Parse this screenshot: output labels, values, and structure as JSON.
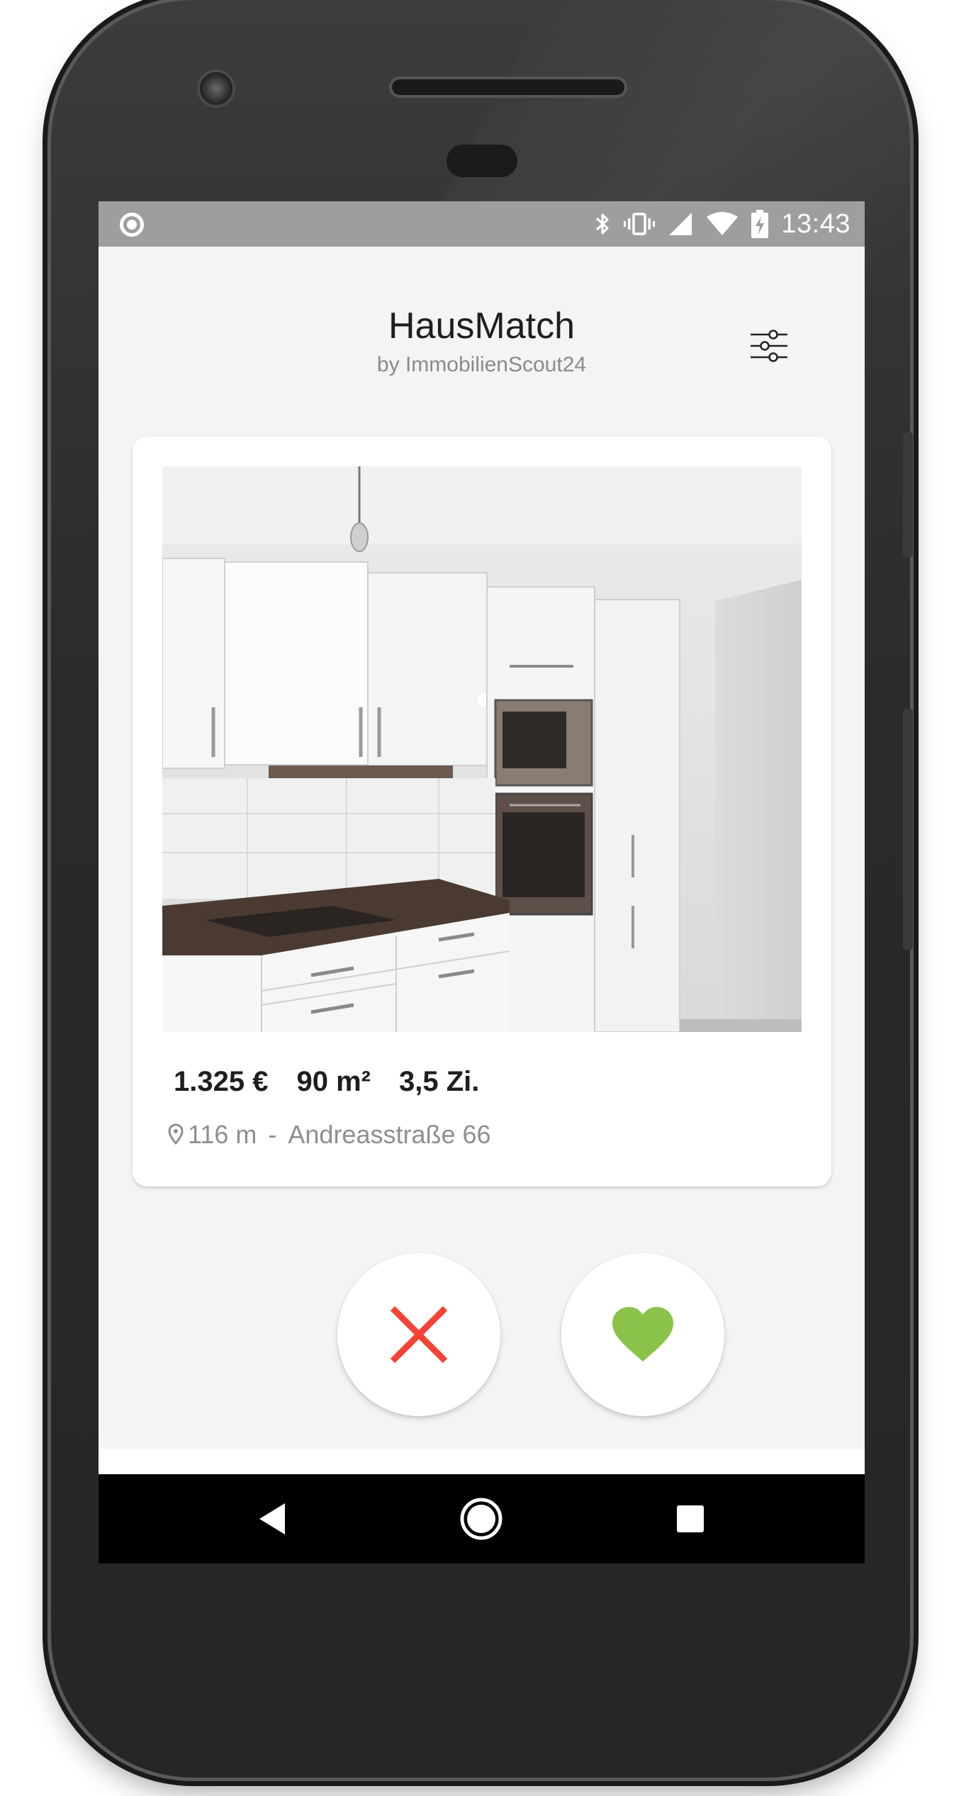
{
  "status_bar": {
    "time": "13:43",
    "icons": [
      "record-icon",
      "bluetooth-icon",
      "vibrate-icon",
      "signal-icon",
      "wifi-icon",
      "battery-charging-icon"
    ]
  },
  "header": {
    "title": "HausMatch",
    "subtitle": "by ImmobilienScout24",
    "filter_icon": "sliders-icon"
  },
  "listing": {
    "price": "1.325 €",
    "area": "90 m²",
    "rooms": "3,5 Zi.",
    "distance": "116 m",
    "separator": "-",
    "address": "Andreasstraße 66",
    "location_icon": "location-pin-icon"
  },
  "actions": {
    "dislike_icon": "close-icon",
    "dislike_color": "#f44336",
    "like_icon": "heart-icon",
    "like_color": "#8bc34a"
  },
  "nav_bar": {
    "icons": [
      "back-icon",
      "home-icon",
      "recents-icon"
    ]
  }
}
